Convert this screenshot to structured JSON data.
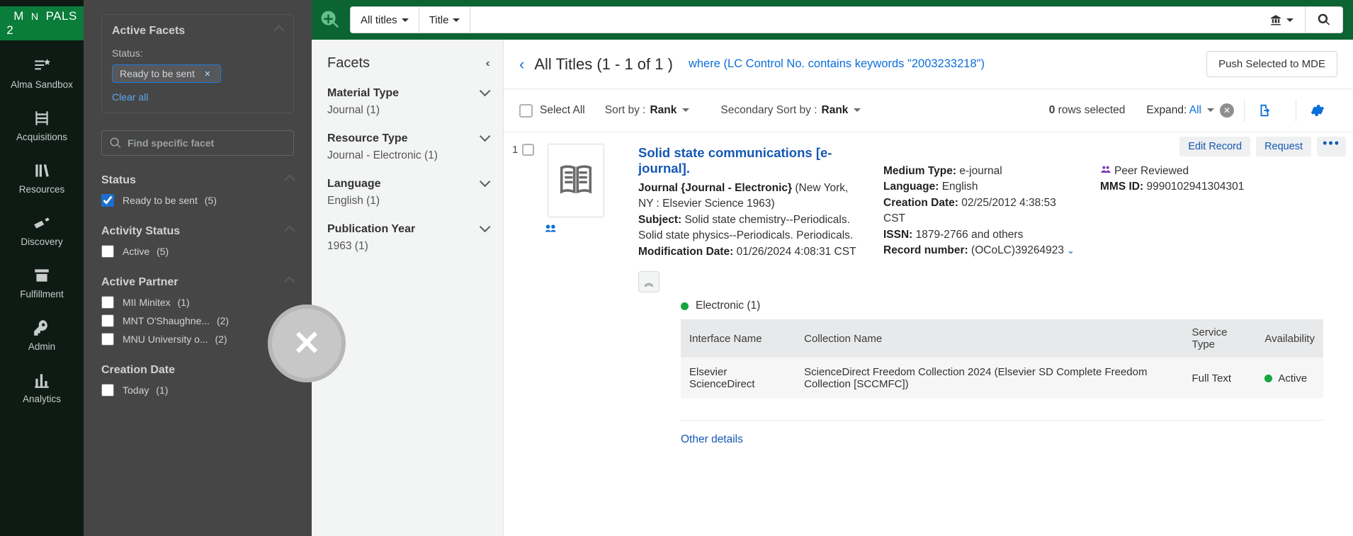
{
  "app": {
    "logo_a": "M",
    "logo_b": "N",
    "logo_c": "PALS 2"
  },
  "nav": {
    "items": [
      {
        "label": "Alma Sandbox"
      },
      {
        "label": "Acquisitions"
      },
      {
        "label": "Resources"
      },
      {
        "label": "Discovery"
      },
      {
        "label": "Fulfillment"
      },
      {
        "label": "Admin"
      },
      {
        "label": "Analytics"
      }
    ]
  },
  "modal": {
    "active_facets_title": "Active Facets",
    "status_label": "Status:",
    "chip": "Ready to be sent",
    "clear_all": "Clear all",
    "find_facet_placeholder": "Find specific facet",
    "status": {
      "title": "Status",
      "opt": "Ready to be sent",
      "count": "(5)"
    },
    "activity": {
      "title": "Activity Status",
      "opt": "Active",
      "count": "(5)"
    },
    "partner": {
      "title": "Active Partner",
      "opts": [
        {
          "label": "MII Minitex",
          "count": "(1)"
        },
        {
          "label": "MNT O'Shaughne...",
          "count": "(2)"
        },
        {
          "label": "MNU University o...",
          "count": "(2)"
        }
      ]
    },
    "creation": {
      "title": "Creation Date",
      "opt": "Today",
      "count": "(1)"
    }
  },
  "topbar": {
    "scope": "All titles",
    "field": "Title"
  },
  "facets": {
    "title": "Facets",
    "material": {
      "title": "Material Type",
      "opt": "Journal (1)"
    },
    "resource": {
      "title": "Resource Type",
      "opt": "Journal - Electronic (1)"
    },
    "language": {
      "title": "Language",
      "opt": "English (1)"
    },
    "pubyear": {
      "title": "Publication Year",
      "opt": "1963 (1)"
    }
  },
  "results": {
    "heading": "All Titles (1 - 1 of 1 )",
    "query": "where (LC Control No. contains keywords \"2003233218\")",
    "push": "Push Selected to MDE",
    "select_all": "Select All",
    "sort_by_label": "Sort by :",
    "sort_by": "Rank",
    "sec_sort_label": "Secondary Sort by :",
    "sec_sort": "Rank",
    "rows_selected_n": "0",
    "rows_selected_t": "rows selected",
    "expand_label": "Expand:",
    "expand_val": "All"
  },
  "record": {
    "index": "1",
    "title": "Solid state communications [e-journal].",
    "type_line_a": "Journal {Journal - Electronic}",
    "type_line_b": "(New York, NY : Elsevier Science 1963)",
    "subject_label": "Subject:",
    "subject": "Solid state chemistry--Periodicals. Solid state physics--Periodicals. Periodicals.",
    "mod_label": "Modification Date:",
    "mod": "01/26/2024 4:08:31 CST",
    "medium_label": "Medium Type:",
    "medium": "e-journal",
    "lang_label": "Language:",
    "lang": "English",
    "creation_label": "Creation Date:",
    "creation": "02/25/2012 4:38:53 CST",
    "issn_label": "ISSN:",
    "issn": "1879-2766 and others",
    "recnum_label": "Record number:",
    "recnum": "(OCoLC)39264923",
    "peer": "Peer Reviewed",
    "mms_label": "MMS ID:",
    "mms": "9990102941304301",
    "edit": "Edit Record",
    "request": "Request",
    "electronic": "Electronic (1)",
    "table": {
      "h1": "Interface Name",
      "h2": "Collection Name",
      "h3": "Service Type",
      "h4": "Availability",
      "c1": "Elsevier ScienceDirect",
      "c2": "ScienceDirect Freedom Collection 2024 (Elsevier SD Complete Freedom Collection [SCCMFC])",
      "c3": "Full Text",
      "c4": "Active"
    },
    "other": "Other details"
  }
}
